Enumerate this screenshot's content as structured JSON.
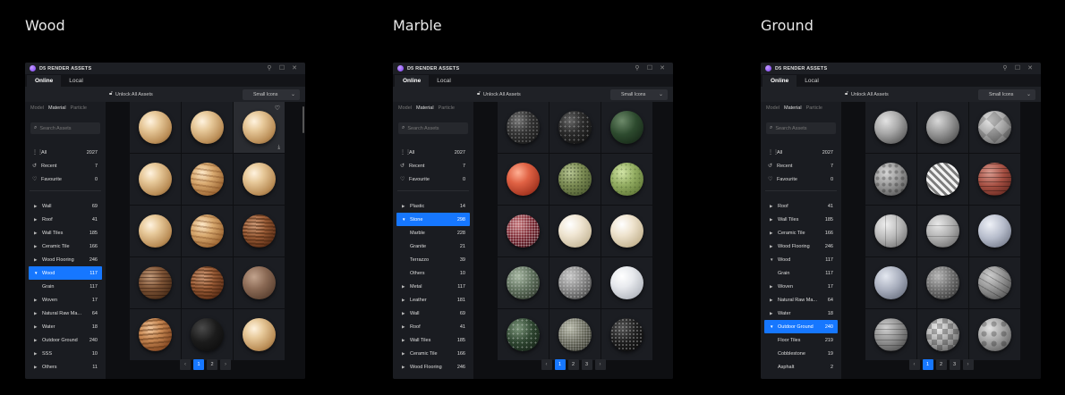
{
  "panels": [
    {
      "caption": "Wood",
      "window_title": "D5 RENDER ASSETS",
      "tabs": [
        "Online",
        "Local"
      ],
      "unlock_label": "Unlock All Assets",
      "view_select": "Small Icons",
      "subtabs": [
        "Model",
        "Material",
        "Particle"
      ],
      "search_placeholder": "Search Assets",
      "quick": [
        {
          "label": "All",
          "count": "2027",
          "icon": "grid-icon"
        },
        {
          "label": "Recent",
          "count": "7",
          "icon": "history-icon"
        },
        {
          "label": "Favourite",
          "count": "0",
          "icon": "heart-icon"
        }
      ],
      "categories": [
        {
          "label": "Wall",
          "count": "69",
          "level": 0
        },
        {
          "label": "Roof",
          "count": "41",
          "level": 0
        },
        {
          "label": "Wall Tiles",
          "count": "185",
          "level": 0
        },
        {
          "label": "Ceramic Tile",
          "count": "166",
          "level": 0
        },
        {
          "label": "Wood Flooring",
          "count": "246",
          "level": 0
        },
        {
          "label": "Wood",
          "count": "117",
          "level": 0,
          "selected": true,
          "expanded": true
        },
        {
          "label": "Grain",
          "count": "117",
          "level": 1
        },
        {
          "label": "Woven",
          "count": "17",
          "level": 0
        },
        {
          "label": "Natural Raw Ma...",
          "count": "64",
          "level": 0
        },
        {
          "label": "Water",
          "count": "18",
          "level": 0
        },
        {
          "label": "Outdoor Ground",
          "count": "240",
          "level": 0
        },
        {
          "label": "SSS",
          "count": "10",
          "level": 0
        },
        {
          "label": "Others",
          "count": "11",
          "level": 0
        }
      ],
      "materials": [
        "wood-a",
        "wood-a",
        "wood-a",
        "wood-a",
        "wood-b",
        "wood-a",
        "wood-a",
        "wood-b",
        "wood-d",
        "wood-e",
        "wood-d",
        "wood-f",
        "wood-c",
        "black",
        "wood-a"
      ],
      "pages": [
        "1",
        "2"
      ],
      "current_page": "1"
    },
    {
      "caption": "Marble",
      "window_title": "D5 RENDER ASSETS",
      "tabs": [
        "Online",
        "Local"
      ],
      "unlock_label": "Unlock All Assets",
      "view_select": "Small Icons",
      "subtabs": [
        "Model",
        "Material",
        "Particle"
      ],
      "search_placeholder": "Search Assets",
      "quick": [
        {
          "label": "All",
          "count": "2027",
          "icon": "grid-icon"
        },
        {
          "label": "Recent",
          "count": "7",
          "icon": "history-icon"
        },
        {
          "label": "Favourite",
          "count": "0",
          "icon": "heart-icon"
        }
      ],
      "categories": [
        {
          "label": "Plastic",
          "count": "14",
          "level": 0
        },
        {
          "label": "Stone",
          "count": "298",
          "level": 0,
          "selected": true,
          "expanded": true
        },
        {
          "label": "Marble",
          "count": "228",
          "level": 1
        },
        {
          "label": "Granite",
          "count": "21",
          "level": 1
        },
        {
          "label": "Terrazzo",
          "count": "39",
          "level": 1
        },
        {
          "label": "Others",
          "count": "10",
          "level": 1
        },
        {
          "label": "Metal",
          "count": "117",
          "level": 0
        },
        {
          "label": "Leather",
          "count": "181",
          "level": 0
        },
        {
          "label": "Wall",
          "count": "69",
          "level": 0
        },
        {
          "label": "Roof",
          "count": "41",
          "level": 0
        },
        {
          "label": "Wall Tiles",
          "count": "185",
          "level": 0
        },
        {
          "label": "Ceramic Tile",
          "count": "166",
          "level": 0
        },
        {
          "label": "Wood Flooring",
          "count": "246",
          "level": 0
        }
      ],
      "materials": [
        "m-black",
        "m-dark",
        "m-green-dark",
        "m-red",
        "m-olive",
        "m-lime",
        "m-redgranite",
        "m-cream",
        "m-cream2",
        "m-greygreen",
        "m-grey",
        "m-white",
        "m-greendots",
        "m-mixgrey",
        "m-blackdots"
      ],
      "pages": [
        "1",
        "2",
        "3"
      ],
      "current_page": "1"
    },
    {
      "caption": "Ground",
      "window_title": "D5 RENDER ASSETS",
      "tabs": [
        "Online",
        "Local"
      ],
      "unlock_label": "Unlock All Assets",
      "view_select": "Small Icons",
      "subtabs": [
        "Model",
        "Material",
        "Particle"
      ],
      "search_placeholder": "Search Assets",
      "quick": [
        {
          "label": "All",
          "count": "2027",
          "icon": "grid-icon"
        },
        {
          "label": "Recent",
          "count": "7",
          "icon": "history-icon"
        },
        {
          "label": "Favourite",
          "count": "0",
          "icon": "heart-icon"
        }
      ],
      "categories": [
        {
          "label": "Roof",
          "count": "41",
          "level": 0
        },
        {
          "label": "Wall Tiles",
          "count": "185",
          "level": 0
        },
        {
          "label": "Ceramic Tile",
          "count": "166",
          "level": 0
        },
        {
          "label": "Wood Flooring",
          "count": "246",
          "level": 0
        },
        {
          "label": "Wood",
          "count": "117",
          "level": 0,
          "expanded": true
        },
        {
          "label": "Grain",
          "count": "117",
          "level": 1
        },
        {
          "label": "Woven",
          "count": "17",
          "level": 0
        },
        {
          "label": "Natural Raw Ma...",
          "count": "64",
          "level": 0
        },
        {
          "label": "Water",
          "count": "18",
          "level": 0
        },
        {
          "label": "Outdoor Ground",
          "count": "240",
          "level": 0,
          "selected": true,
          "expanded": true
        },
        {
          "label": "Floor Tiles",
          "count": "219",
          "level": 1
        },
        {
          "label": "Cobblestone",
          "count": "19",
          "level": 1
        },
        {
          "label": "Asphalt",
          "count": "2",
          "level": 1
        }
      ],
      "materials": [
        "g-concrete",
        "g-concrete2",
        "g-checker",
        "g-cobble",
        "g-chevron",
        "g-brick",
        "g-tile",
        "g-tile2",
        "g-blue",
        "g-blue2",
        "g-darkstone",
        "g-cracked",
        "g-plank",
        "g-check2",
        "g-moon"
      ],
      "pages": [
        "1",
        "2",
        "3"
      ],
      "current_page": "1"
    }
  ]
}
